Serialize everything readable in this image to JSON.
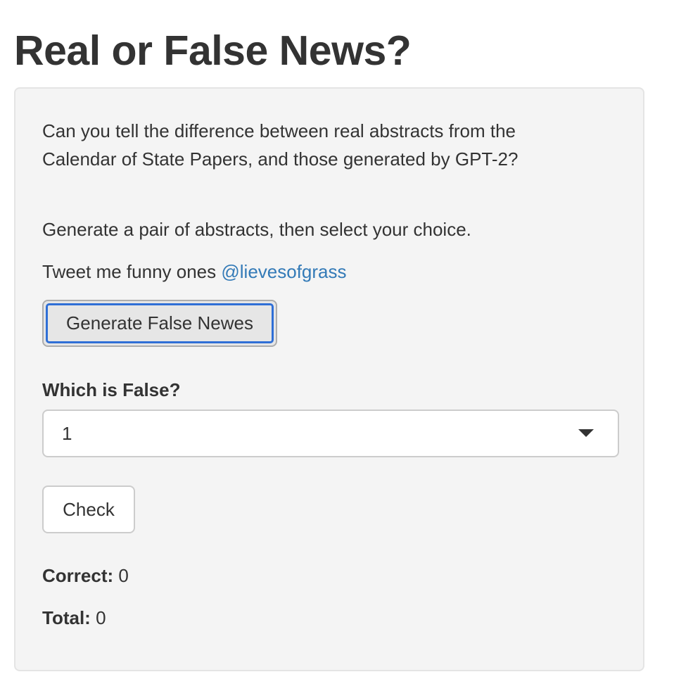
{
  "page": {
    "title": "Real or False News?"
  },
  "panel": {
    "intro_text": "Can you tell the difference between real abstracts from the Calendar of State Papers, and those generated by GPT-2?",
    "instruction_text": "Generate a pair of abstracts, then select your choice.",
    "tweet_prefix": "Tweet me funny ones",
    "tweet_handle": "@lievesofgrass",
    "generate_button_label": "Generate False Newes",
    "select_label": "Which is False?",
    "select_value": "1",
    "check_button_label": "Check",
    "correct_label": "Correct:",
    "correct_value": "0",
    "total_label": "Total:",
    "total_value": "0"
  },
  "colors": {
    "link": "#337ab7",
    "focus_ring": "#2f6fd6",
    "panel_bg": "#f4f4f4",
    "text": "#333333"
  }
}
